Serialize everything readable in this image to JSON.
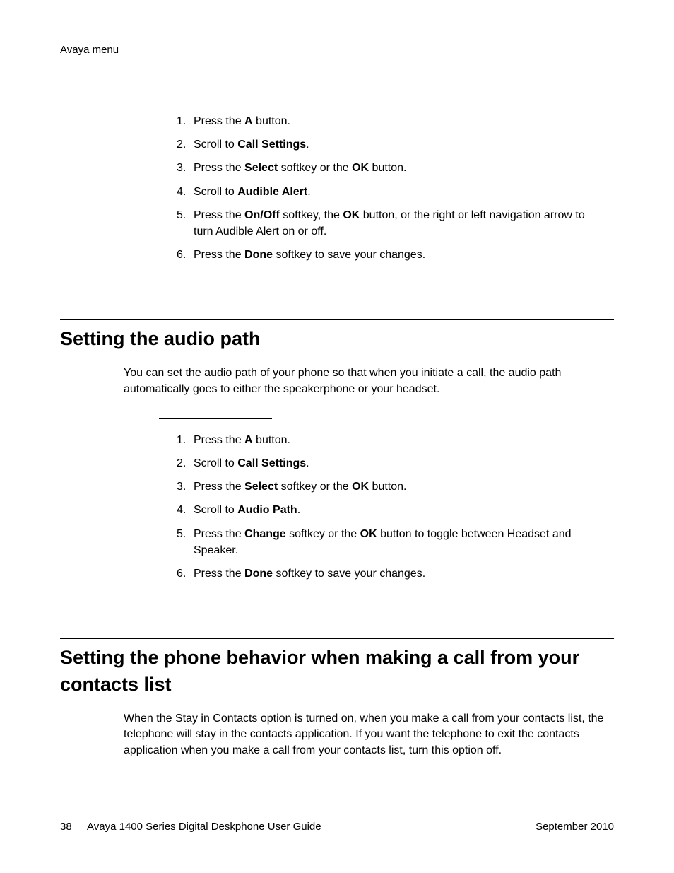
{
  "header": {
    "breadcrumb": "Avaya menu"
  },
  "section1": {
    "steps": [
      [
        {
          "t": "Press the "
        },
        {
          "t": "A",
          "b": true
        },
        {
          "t": " button."
        }
      ],
      [
        {
          "t": "Scroll to "
        },
        {
          "t": "Call Settings",
          "b": true
        },
        {
          "t": "."
        }
      ],
      [
        {
          "t": "Press the "
        },
        {
          "t": "Select",
          "b": true
        },
        {
          "t": " softkey or the "
        },
        {
          "t": "OK",
          "b": true
        },
        {
          "t": " button."
        }
      ],
      [
        {
          "t": "Scroll to "
        },
        {
          "t": "Audible Alert",
          "b": true
        },
        {
          "t": "."
        }
      ],
      [
        {
          "t": "Press the "
        },
        {
          "t": "On/Off",
          "b": true
        },
        {
          "t": " softkey, the "
        },
        {
          "t": "OK",
          "b": true
        },
        {
          "t": " button, or the right or left navigation arrow to turn Audible Alert on or off."
        }
      ],
      [
        {
          "t": "Press the "
        },
        {
          "t": "Done",
          "b": true
        },
        {
          "t": " softkey to save your changes."
        }
      ]
    ]
  },
  "section2": {
    "title": "Setting the audio path",
    "intro": "You can set the audio path of your phone so that when you initiate a call, the audio path automatically goes to either the speakerphone or your headset.",
    "steps": [
      [
        {
          "t": "Press the "
        },
        {
          "t": "A",
          "b": true
        },
        {
          "t": " button."
        }
      ],
      [
        {
          "t": "Scroll to "
        },
        {
          "t": "Call Settings",
          "b": true
        },
        {
          "t": "."
        }
      ],
      [
        {
          "t": "Press the "
        },
        {
          "t": "Select",
          "b": true
        },
        {
          "t": " softkey or the "
        },
        {
          "t": "OK",
          "b": true
        },
        {
          "t": " button."
        }
      ],
      [
        {
          "t": "Scroll to "
        },
        {
          "t": "Audio Path",
          "b": true
        },
        {
          "t": "."
        }
      ],
      [
        {
          "t": "Press the "
        },
        {
          "t": "Change",
          "b": true
        },
        {
          "t": " softkey or the "
        },
        {
          "t": "OK",
          "b": true
        },
        {
          "t": " button to toggle between Headset and Speaker."
        }
      ],
      [
        {
          "t": "Press the "
        },
        {
          "t": "Done",
          "b": true
        },
        {
          "t": " softkey to save your changes."
        }
      ]
    ]
  },
  "section3": {
    "title": "Setting the phone behavior when making a call from your contacts list",
    "intro": "When the Stay in Contacts option is turned on, when you make a call from your contacts list, the telephone will stay in the contacts application. If you want the telephone to exit the contacts application when you make a call from your contacts list, turn this option off."
  },
  "footer": {
    "page": "38",
    "doc": "Avaya 1400 Series Digital Deskphone User Guide",
    "date": "September 2010"
  }
}
